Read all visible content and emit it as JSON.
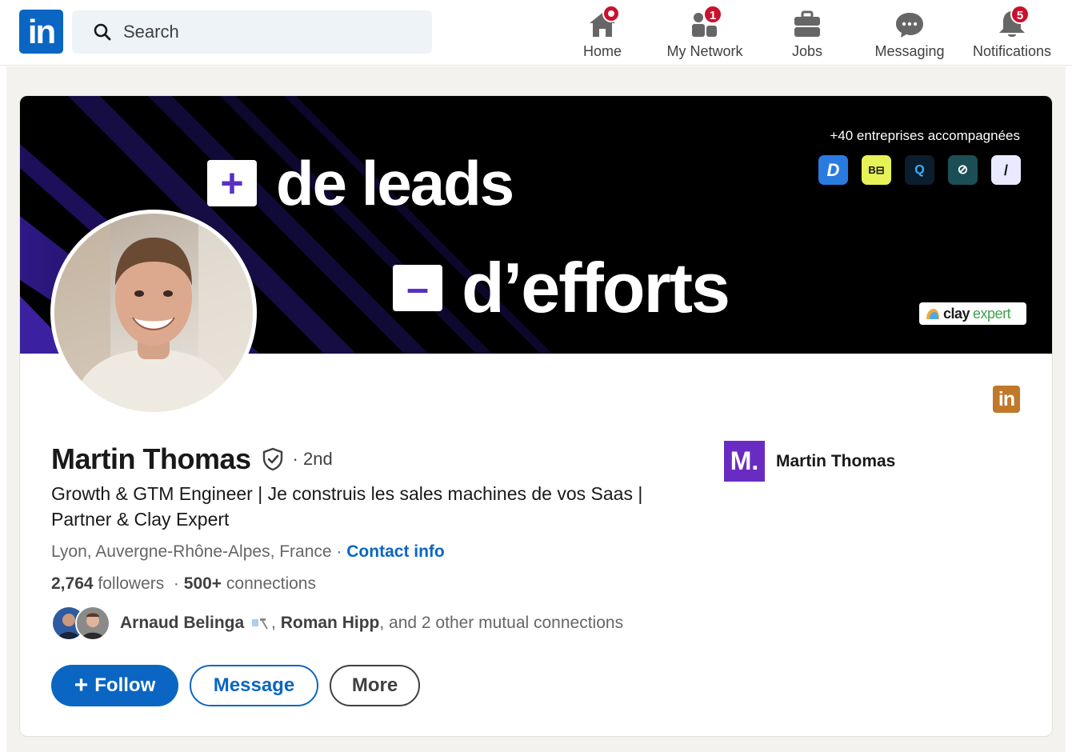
{
  "colors": {
    "brand": "#0a66c2",
    "badge": "#cb112d",
    "banner_accent": "#5a2fc4"
  },
  "nav": {
    "logo": "in",
    "search_placeholder": "Search",
    "items": [
      {
        "label": "Home",
        "icon": "home-icon",
        "badge": ""
      },
      {
        "label": "My Network",
        "icon": "network-icon",
        "badge": "1"
      },
      {
        "label": "Jobs",
        "icon": "briefcase-icon",
        "badge": ""
      },
      {
        "label": "Messaging",
        "icon": "message-icon",
        "badge": ""
      },
      {
        "label": "Notifications",
        "icon": "bell-icon",
        "badge": "5"
      }
    ]
  },
  "banner": {
    "plus": "+",
    "line1": "de leads",
    "minus": "–",
    "line2": "d’efforts",
    "accompanied": "+40 entreprises accompagnées",
    "badge_clay": "clay",
    "badge_expert": "expert"
  },
  "profile": {
    "name": "Martin Thomas",
    "degree": "· 2nd",
    "headline": "Growth & GTM Engineer | Je construis les sales machines de vos Saas | Partner & Clay Expert",
    "location": "Lyon, Auvergne-Rhône-Alpes, France",
    "location_sep": " · ",
    "contact_info": "Contact info",
    "followers_count": "2,764",
    "followers_label": " followers",
    "stats_sep": "  · ",
    "connections_count": "500+",
    "connections_label": " connections",
    "mutual_name1": "Arnaud Belinga",
    "mutual_sep": ", ",
    "mutual_name2": "Roman Hipp",
    "mutual_rest": ", and 2 other mutual connections"
  },
  "actions": {
    "follow": "Follow",
    "message": "Message",
    "more": "More"
  },
  "company": {
    "logo": "M.",
    "name": "Martin Thomas"
  },
  "corner_badge": "in"
}
